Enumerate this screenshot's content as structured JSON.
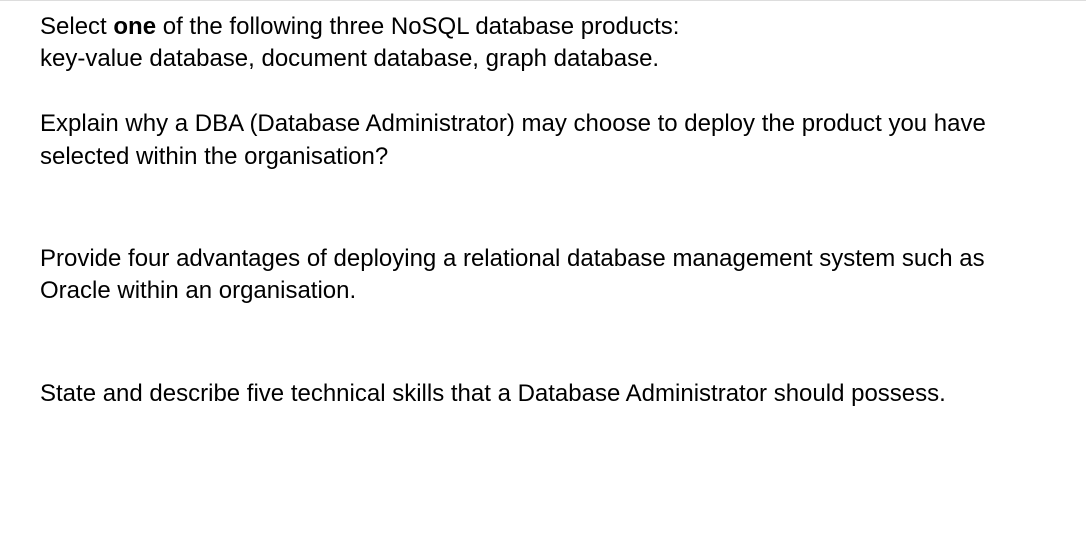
{
  "questions": {
    "q1": {
      "line1_before": "Select ",
      "line1_bold": "one",
      "line1_after": " of the following three NoSQL database products:",
      "line2": "key-value database, document database, graph database.",
      "line3": "Explain why a DBA (Database Administrator) may choose to deploy the product you have selected within the organisation?"
    },
    "q2": {
      "text": "Provide four advantages of deploying a relational database management system such as Oracle within an organisation."
    },
    "q3": {
      "text": "State and describe five technical skills that a Database Administrator should possess."
    }
  }
}
